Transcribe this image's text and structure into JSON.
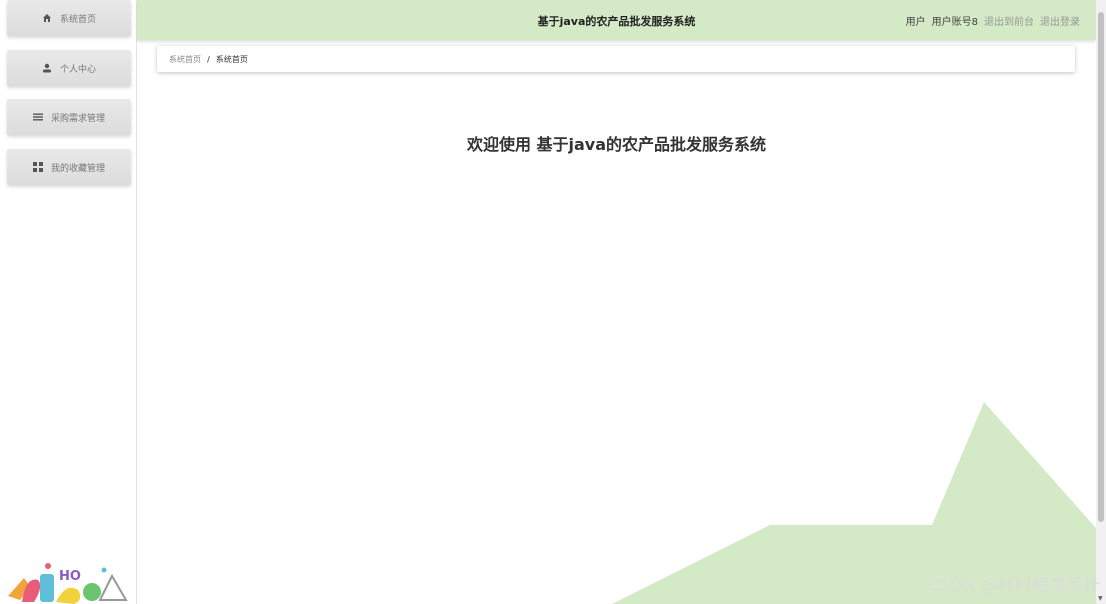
{
  "sidebar": {
    "items": [
      {
        "label": "系统首页",
        "icon": "home-icon"
      },
      {
        "label": "个人中心",
        "icon": "user-icon"
      },
      {
        "label": "采购需求管理",
        "icon": "list-icon"
      },
      {
        "label": "我的收藏管理",
        "icon": "grid-icon"
      }
    ]
  },
  "header": {
    "title": "基于java的农产品批发服务系统",
    "user_role": "用户",
    "username": "用户账号8",
    "exit_front": "退出到前台",
    "logout": "退出登录"
  },
  "breadcrumb": {
    "home": "系统首页",
    "separator": "/",
    "current": "系统首页"
  },
  "main": {
    "welcome": "欢迎使用 基于java的农产品批发服务系统"
  },
  "watermark": "CSDN @林科程序设计",
  "colors": {
    "accent": "#d4e9c5",
    "sidebar_item": "#e2e2e2",
    "text": "#333333"
  }
}
